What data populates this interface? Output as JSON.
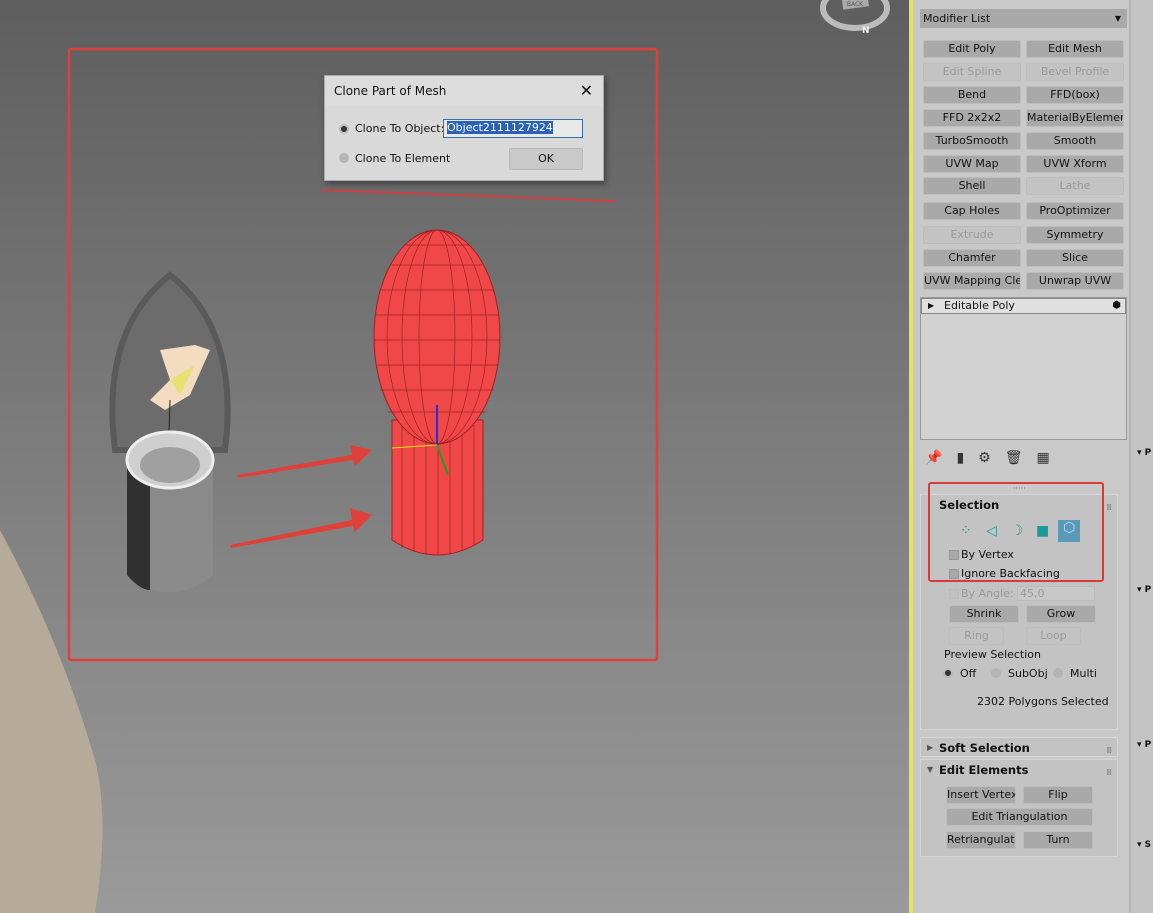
{
  "viewport": {
    "viewcube_label": "BACK",
    "compass_label": "N"
  },
  "dialog": {
    "title": "Clone Part of Mesh",
    "option_object": "Clone To Object:",
    "option_element": "Clone To Element",
    "object_name": "Object2111127924",
    "ok_label": "OK",
    "selected_option": "Clone To Object"
  },
  "modifier_list": {
    "label": "Modifier List",
    "buttons": [
      {
        "label": "Edit Poly",
        "enabled": true
      },
      {
        "label": "Edit Mesh",
        "enabled": true
      },
      {
        "label": "Edit Spline",
        "enabled": false
      },
      {
        "label": "Bevel Profile",
        "enabled": false
      },
      {
        "label": "Bend",
        "enabled": true
      },
      {
        "label": "FFD(box)",
        "enabled": true
      },
      {
        "label": "FFD 2x2x2",
        "enabled": true
      },
      {
        "label": "MaterialByElement",
        "enabled": true
      },
      {
        "label": "TurboSmooth",
        "enabled": true
      },
      {
        "label": "Smooth",
        "enabled": true
      },
      {
        "label": "UVW Map",
        "enabled": true
      },
      {
        "label": "UVW Xform",
        "enabled": true
      },
      {
        "label": "Shell",
        "enabled": true
      },
      {
        "label": "Lathe",
        "enabled": false
      },
      {
        "label": "Cap Holes",
        "enabled": true
      },
      {
        "label": "ProOptimizer",
        "enabled": true
      },
      {
        "label": "Extrude",
        "enabled": false
      },
      {
        "label": "Symmetry",
        "enabled": true
      },
      {
        "label": "Chamfer",
        "enabled": true
      },
      {
        "label": "Slice",
        "enabled": true
      },
      {
        "label": "UVW Mapping Clear",
        "enabled": true
      },
      {
        "label": "Unwrap UVW",
        "enabled": true
      }
    ]
  },
  "stack": {
    "item": "Editable Poly"
  },
  "selection": {
    "title": "Selection",
    "by_vertex": "By Vertex",
    "ignore_backfacing": "Ignore Backfacing",
    "by_angle": "By Angle:",
    "angle_value": "45,0",
    "shrink": "Shrink",
    "grow": "Grow",
    "ring": "Ring",
    "loop": "Loop",
    "preview_label": "Preview Selection",
    "preview_off": "Off",
    "preview_subobj": "SubObj",
    "preview_multi": "Multi",
    "status": "2302 Polygons Selected"
  },
  "soft_selection": {
    "title": "Soft Selection"
  },
  "edit_elements": {
    "title": "Edit Elements",
    "insert_vertex": "Insert Vertex",
    "flip": "Flip",
    "edit_triangulation": "Edit Triangulation",
    "retriangulate": "Retriangulate",
    "turn": "Turn"
  },
  "far_panel": {
    "headers": [
      "P",
      "P",
      "P",
      "S"
    ]
  },
  "colors": {
    "annotation_red": "#e0403a",
    "selection_red": "#f04848",
    "accent_teal": "#1a9a9a"
  }
}
